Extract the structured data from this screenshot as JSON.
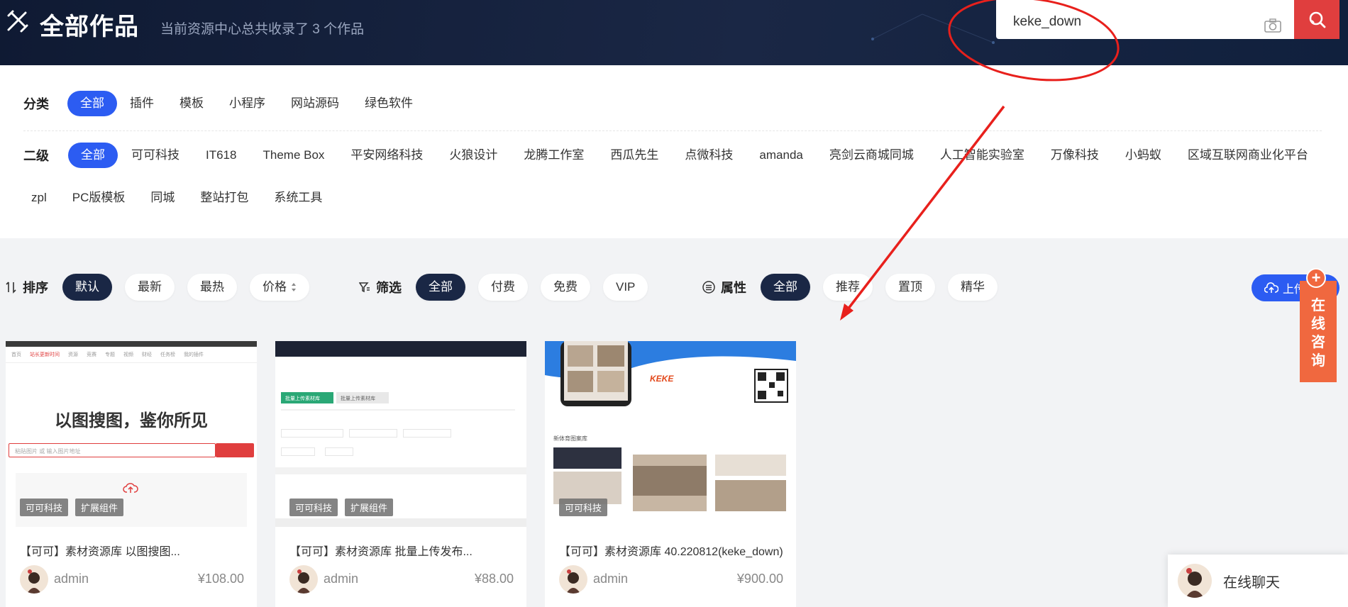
{
  "header": {
    "title": "全部作品",
    "subtitle": "当前资源中心总共收录了 3 个作品",
    "search_value": "keke_down"
  },
  "category": {
    "label": "分类",
    "items": [
      "全部",
      "插件",
      "模板",
      "小程序",
      "网站源码",
      "绿色软件"
    ]
  },
  "secondary": {
    "label": "二级",
    "row1": [
      "全部",
      "可可科技",
      "IT618",
      "Theme Box",
      "平安网络科技",
      "火狼设计",
      "龙腾工作室",
      "西瓜先生",
      "点微科技",
      "amanda",
      "亮剑云商城同城",
      "人工智能实验室",
      "万像科技",
      "小蚂蚁",
      "区域互联网商业化平台"
    ],
    "row2": [
      "zpl",
      "PC版模板",
      "同城",
      "整站打包",
      "系统工具"
    ]
  },
  "sort": {
    "label": "排序",
    "options": [
      "默认",
      "最新",
      "最热",
      "价格"
    ]
  },
  "filter": {
    "label": "筛选",
    "options": [
      "全部",
      "付费",
      "免费",
      "VIP"
    ]
  },
  "attribute": {
    "label": "属性",
    "options": [
      "全部",
      "推荐",
      "置顶",
      "精华"
    ]
  },
  "upload_label": "上传",
  "cards": [
    {
      "tags": [
        "可可科技",
        "扩展组件"
      ],
      "title": "【可可】素材资源库 以图搜图...",
      "author": "admin",
      "price": "¥108.00",
      "thumb": {
        "heading": "以图搜图，鉴你所见",
        "placeholder": "粘贴图片 或 输入图片地址",
        "nav": [
          "首页",
          "站长更新时间",
          "资源",
          "竞赛",
          "专题",
          "视频",
          "财经",
          "任务榜",
          "我的插件"
        ]
      }
    },
    {
      "tags": [
        "可可科技",
        "扩展组件"
      ],
      "title": "【可可】素材资源库 批量上传发布...",
      "author": "admin",
      "price": "¥88.00",
      "thumb": {
        "tab_active": "批量上传素材库",
        "tab_inactive": "批量上传素材库"
      }
    },
    {
      "tags": [
        "可可科技"
      ],
      "title": "【可可】素材资源库 40.220812(keke_down)",
      "author": "admin",
      "price": "¥900.00",
      "thumb": {
        "brand": "KEKE",
        "section": "新体育图案库"
      }
    }
  ],
  "consult_chars": [
    "在",
    "线",
    "咨",
    "询"
  ],
  "chat_label": "在线聊天",
  "colors": {
    "header_bg": "#1a2745",
    "accent_blue": "#2c5cf2",
    "search_red": "#e03e3e",
    "consult_orange": "#f0683f",
    "annotation_red": "#e8201c"
  }
}
